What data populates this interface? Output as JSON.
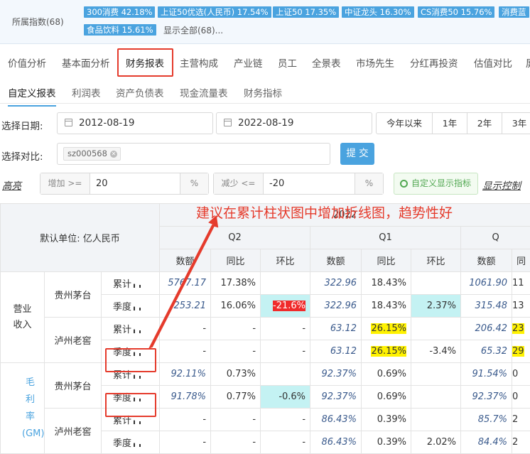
{
  "index_bar": {
    "label": "所属指数(68)",
    "tags": [
      "300消费 42.18%",
      "上证50优选(人民币) 17.54%",
      "上证50 17.35%",
      "中证龙头 16.30%",
      "CS消费50 15.76%",
      "消费蓝",
      "食品饮料 15.61%"
    ],
    "show_all": "显示全部(68)..."
  },
  "main_tabs": [
    "价值分析",
    "基本面分析",
    "财务报表",
    "主营构成",
    "产业链",
    "员工",
    "全景表",
    "市场先生",
    "分红再投资",
    "估值对比",
    "屏"
  ],
  "sub_tabs": [
    "自定义报表",
    "利润表",
    "资产负债表",
    "现金流量表",
    "财务指标"
  ],
  "date": {
    "label": "选择日期:",
    "start": "2012-08-19",
    "end": "2022-08-19"
  },
  "ranges": [
    "今年以来",
    "1年",
    "2年",
    "3年"
  ],
  "compare": {
    "label": "选择对比:",
    "chip": "sz000568",
    "submit": "提 交"
  },
  "highlight": {
    "label": "高亮",
    "inc_prefix": "增加 >=",
    "inc_val": "20",
    "inc_unit": "%",
    "dec_prefix": "减少 <=",
    "dec_val": "-20",
    "dec_unit": "%",
    "custom_btn": "自定义显示指标",
    "display_ctrl": "显示控制"
  },
  "annotation": "建议在累计柱状图中增加折线图，趋势性好",
  "table": {
    "unit_label": "默认单位: 亿人民币",
    "year": "2022",
    "quarters": [
      "Q2",
      "Q1",
      "Q"
    ],
    "col_heads": [
      "数额",
      "同比",
      "环比",
      "数额",
      "同比",
      "环比",
      "数额",
      "同"
    ],
    "metric_revenue": "营业收入",
    "metric_margin": "毛利率(GM)",
    "companies": [
      "贵州茅台",
      "泸州老窖"
    ],
    "kinds": [
      "累计",
      "季度"
    ],
    "rows": [
      [
        "5767.17",
        "17.38%",
        "",
        "322.96",
        "18.43%",
        "",
        "1061.90",
        "11"
      ],
      [
        "253.21",
        "16.06%",
        "-21.6%",
        "322.96",
        "18.43%",
        "2.37%",
        "315.48",
        "13"
      ],
      [
        "-",
        "-",
        "-",
        "63.12",
        "26.15%",
        "",
        "206.42",
        "23"
      ],
      [
        "-",
        "-",
        "-",
        "63.12",
        "26.15%",
        "-3.4%",
        "65.32",
        "29"
      ],
      [
        "92.11%",
        "0.73%",
        "",
        "92.37%",
        "0.69%",
        "",
        "91.54%",
        "0"
      ],
      [
        "91.78%",
        "0.77%",
        "-0.6%",
        "92.37%",
        "0.69%",
        "",
        "92.37%",
        "0"
      ],
      [
        "-",
        "-",
        "-",
        "86.43%",
        "0.39%",
        "",
        "85.7%",
        "2"
      ],
      [
        "-",
        "-",
        "-",
        "86.43%",
        "0.39%",
        "2.02%",
        "84.4%",
        "2"
      ]
    ]
  },
  "colors": {
    "accent": "#4aa3df",
    "annotation_red": "#e53b2c",
    "cyan": "#c4f2f3",
    "yellow": "#fff200",
    "neg_red": "#f02b2b"
  }
}
